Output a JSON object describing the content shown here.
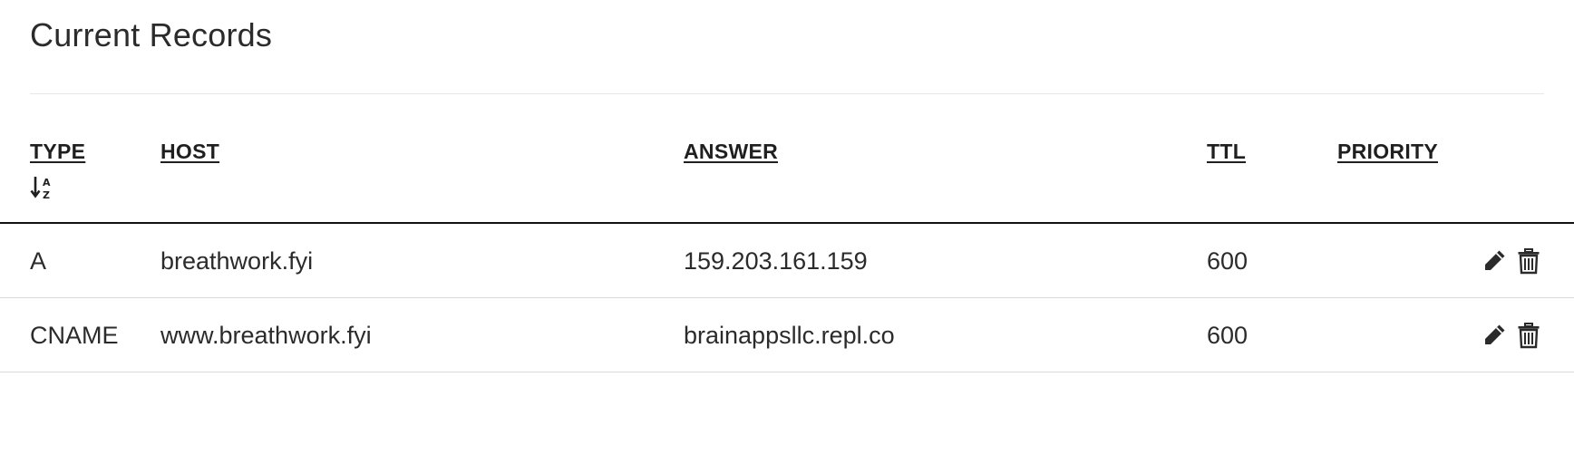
{
  "page": {
    "title": "Current Records"
  },
  "table": {
    "columns": {
      "type": "TYPE",
      "host": "HOST",
      "answer": "ANSWER",
      "ttl": "TTL",
      "priority": "PRIORITY"
    },
    "sort_icon": "sort-alpha-down-icon",
    "rows": [
      {
        "type": "A",
        "host": "breathwork.fyi",
        "answer": "159.203.161.159",
        "ttl": "600",
        "priority": ""
      },
      {
        "type": "CNAME",
        "host": "www.breathwork.fyi",
        "answer": "brainappsllc.repl.co",
        "ttl": "600",
        "priority": ""
      }
    ],
    "row_actions": [
      "pencil-icon",
      "trash-icon"
    ]
  },
  "colors": {
    "text": "#2b2b2b",
    "header_rule": "#111111",
    "row_rule": "#d9d9d9",
    "title_rule": "#e6e6e6"
  }
}
